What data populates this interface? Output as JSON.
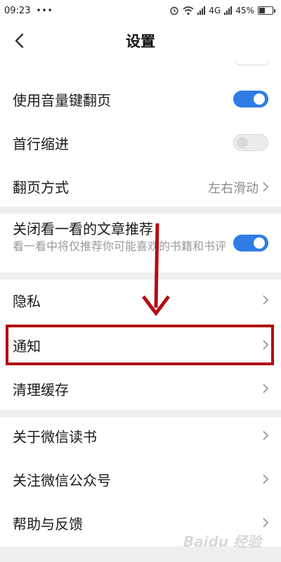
{
  "status_bar": {
    "time": "09:23",
    "notifications": "•••",
    "network": "4G",
    "battery": "45%",
    "battery_level": 0.45
  },
  "nav": {
    "title": "设置",
    "back_icon": "chevron-left-icon"
  },
  "settings": {
    "page_turn_volume": {
      "label": "使用音量键翻页",
      "enabled": true
    },
    "first_line_indent": {
      "label": "首行缩进",
      "enabled": false
    },
    "page_turn_mode": {
      "label": "翻页方式",
      "value": "左右滑动"
    },
    "close_recommend": {
      "label": "关闭看一看的文章推荐",
      "description": "看一看中将仅推荐你可能喜欢的书籍和书评",
      "enabled": true
    },
    "privacy": {
      "label": "隐私"
    },
    "notifications": {
      "label": "通知"
    },
    "clear_cache": {
      "label": "清理缓存"
    },
    "about": {
      "label": "关于微信读书"
    },
    "follow_account": {
      "label": "关注微信公众号"
    },
    "help_feedback": {
      "label": "帮助与反馈"
    }
  },
  "colors": {
    "accent": "#2f7ce5",
    "highlight": "#b20d12",
    "divider": "#efefef"
  },
  "watermark": "Baidu 经验"
}
